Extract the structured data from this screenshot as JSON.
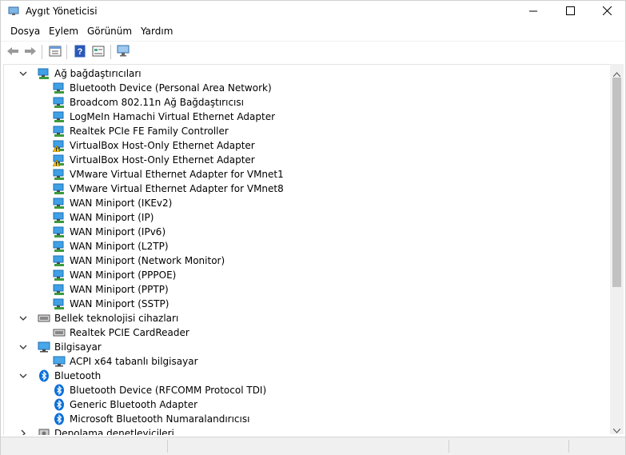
{
  "window": {
    "title": "Aygıt Yöneticisi"
  },
  "menu": {
    "items": [
      "Dosya",
      "Eylem",
      "Görünüm",
      "Yardım"
    ]
  },
  "toolbar": {
    "buttons": [
      "back-arrow-icon",
      "forward-arrow-icon",
      "properties-icon",
      "help-icon",
      "update-driver-icon",
      "scan-hardware-icon"
    ]
  },
  "tree": {
    "network": {
      "label": "Ağ bağdaştırıcıları",
      "items": [
        {
          "label": "Bluetooth Device (Personal Area Network)",
          "warn": false
        },
        {
          "label": "Broadcom 802.11n Ağ Bağdaştırıcısı",
          "warn": false
        },
        {
          "label": "LogMeIn Hamachi Virtual Ethernet Adapter",
          "warn": false
        },
        {
          "label": "Realtek PCIe FE Family Controller",
          "warn": false
        },
        {
          "label": "VirtualBox Host-Only Ethernet Adapter",
          "warn": true
        },
        {
          "label": "VirtualBox Host-Only Ethernet Adapter",
          "warn": true
        },
        {
          "label": "VMware Virtual Ethernet Adapter for VMnet1",
          "warn": false
        },
        {
          "label": "VMware Virtual Ethernet Adapter for VMnet8",
          "warn": false
        },
        {
          "label": "WAN Miniport (IKEv2)",
          "warn": false
        },
        {
          "label": "WAN Miniport (IP)",
          "warn": false
        },
        {
          "label": "WAN Miniport (IPv6)",
          "warn": false
        },
        {
          "label": "WAN Miniport (L2TP)",
          "warn": false
        },
        {
          "label": "WAN Miniport (Network Monitor)",
          "warn": false
        },
        {
          "label": "WAN Miniport (PPPOE)",
          "warn": false
        },
        {
          "label": "WAN Miniport (PPTP)",
          "warn": false
        },
        {
          "label": "WAN Miniport (SSTP)",
          "warn": false
        }
      ]
    },
    "memory": {
      "label": "Bellek teknolojisi cihazları",
      "items": [
        {
          "label": "Realtek PCIE CardReader"
        }
      ]
    },
    "computer": {
      "label": "Bilgisayar",
      "items": [
        {
          "label": "ACPI x64 tabanlı bilgisayar"
        }
      ]
    },
    "bluetooth": {
      "label": "Bluetooth",
      "items": [
        {
          "label": "Bluetooth Device (RFCOMM Protocol TDI)"
        },
        {
          "label": "Generic Bluetooth Adapter"
        },
        {
          "label": "Microsoft Bluetooth Numaralandırıcısı"
        }
      ]
    },
    "storage": {
      "label": "Depolama denetleyicileri"
    }
  },
  "colors": {
    "accent": "#0078d7",
    "warning": "#f4c010",
    "bluetooth": "#0a6fd8"
  }
}
